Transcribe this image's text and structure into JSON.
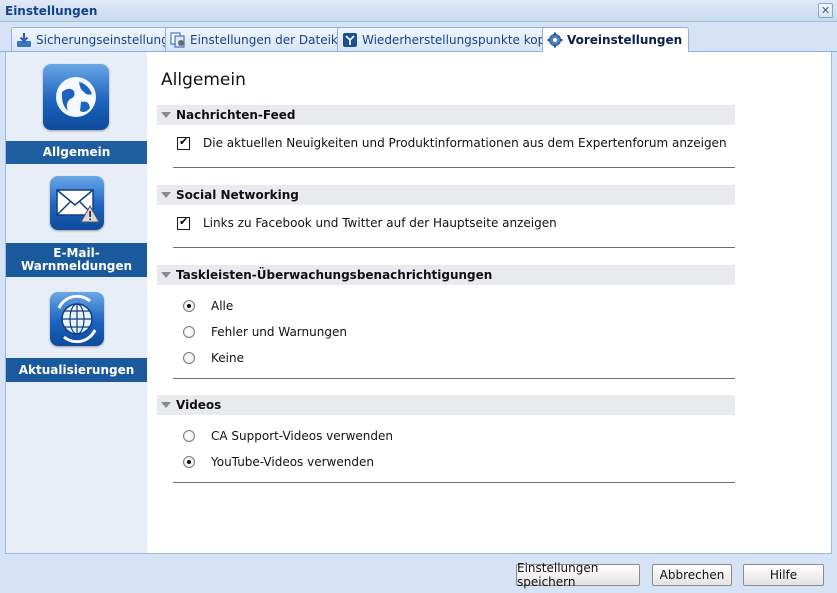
{
  "window": {
    "title": "Einstellungen",
    "close_symbol": "✕"
  },
  "tabs": [
    {
      "label": "Sicherungseinstellungen",
      "icon": "backup-settings-icon",
      "active": false
    },
    {
      "label": "Einstellungen der Dateikopie",
      "icon": "file-copy-settings-icon",
      "active": false
    },
    {
      "label": "Wiederherstellungspunkte kopieren",
      "icon": "copy-recovery-points-icon",
      "active": false
    },
    {
      "label": "Voreinstellungen",
      "icon": "preferences-gear-icon",
      "active": true
    }
  ],
  "sidebar": {
    "items": [
      {
        "label": "Allgemein",
        "icon": "globe-icon",
        "active": true
      },
      {
        "label": "E-Mail-Warnmeldungen",
        "icon": "email-warning-icon",
        "active": false
      },
      {
        "label": "Aktualisierungen",
        "icon": "globe-update-icon",
        "active": false
      }
    ],
    "email_label_line1": "E-Mail-",
    "email_label_line2": "Warnmeldungen"
  },
  "main": {
    "title": "Allgemein",
    "sections": [
      {
        "title": "Nachrichten-Feed",
        "checkbox": {
          "label": "Die aktuellen Neuigkeiten und Produktinformationen aus dem Expertenforum anzeigen",
          "checked": true
        }
      },
      {
        "title": "Social Networking",
        "checkbox": {
          "label": "Links zu Facebook und Twitter auf der Hauptseite anzeigen",
          "checked": true
        }
      },
      {
        "title": "Taskleisten-Überwachungsbenachrichtigungen",
        "radios": [
          {
            "label": "Alle",
            "checked": true
          },
          {
            "label": "Fehler und Warnungen",
            "checked": false
          },
          {
            "label": "Keine",
            "checked": false
          }
        ]
      },
      {
        "title": "Videos",
        "radios": [
          {
            "label": "CA Support-Videos verwenden",
            "checked": false
          },
          {
            "label": "YouTube-Videos verwenden",
            "checked": true
          }
        ]
      }
    ]
  },
  "footer": {
    "save_label": "Einstellungen speichern",
    "cancel_label": "Abbrechen",
    "help_label": "Hilfe"
  }
}
